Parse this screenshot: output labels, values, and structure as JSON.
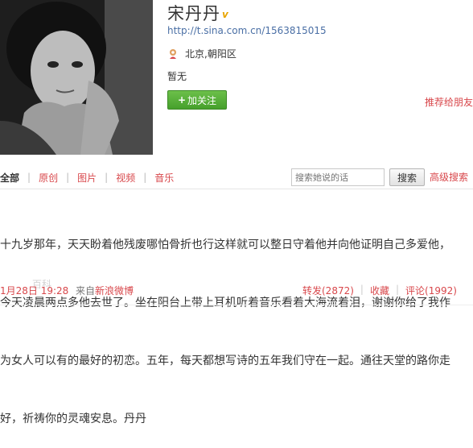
{
  "profile": {
    "name": "宋丹丹",
    "verified_mark": "v",
    "url": "http://t.sina.com.cn/1563815015",
    "location": "北京,朝阳区",
    "bio": "暂无",
    "follow_label": "加关注",
    "follow_plus": "+",
    "recommend_label": "推荐给朋友"
  },
  "tabs": [
    {
      "label": "全部"
    },
    {
      "label": "原创"
    },
    {
      "label": "图片"
    },
    {
      "label": "视频"
    },
    {
      "label": "音乐"
    }
  ],
  "search": {
    "placeholder": "搜索她说的话",
    "button_label": "搜索",
    "advanced_label": "高级搜索"
  },
  "post": {
    "lines": [
      "十九岁那年，天天盼着他残废哪怕骨折也行这样就可以整日守着他并向他证明自己多爱他，",
      "今天凌晨两点多他去世了。坐在阳台上带上耳机听着音乐看着大海流着泪，谢谢你给了我作",
      "为女人可以有的最好的初恋。五年，每天都想写诗的五年我们守在一起。通往天堂的路你走",
      "好，祈祷你的灵魂安息。丹丹"
    ],
    "time": "1月28日 19:28",
    "from_prefix": "来自",
    "source": "新浪微博",
    "watermark": "百科",
    "repost_label": "转发(2872)",
    "favorite_label": "收藏",
    "comment_label": "评论(1992)"
  },
  "colors": {
    "link_red": "#d8474b",
    "url_blue": "#4a6fa5",
    "follow_green": "#46a02c",
    "verified_gold": "#e8a500"
  },
  "icons": {
    "location": "location-pin-icon",
    "verified": "verified-v-icon",
    "avatar": "avatar-photo"
  }
}
